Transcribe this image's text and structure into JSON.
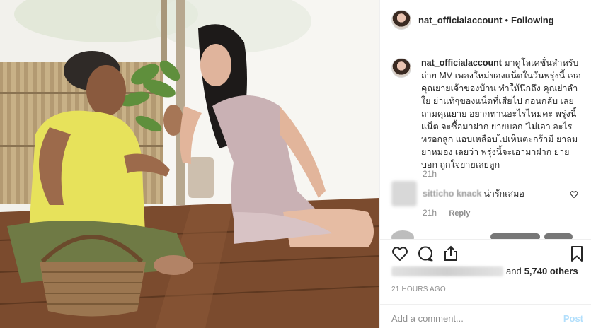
{
  "header": {
    "username": "nat_officialaccount",
    "separator": "•",
    "follow_status": "Following"
  },
  "caption": {
    "username": "nat_officialaccount",
    "text": "มาดูโลเคชั่นสำหรับถ่าย MV เพลงใหม่ของแน็ตในวันพรุ่งนี้ เจอคุณยายเจ้าของบ้าน ทำให้นึกถึง คุณย่าลำใย ย่าแท้ๆของแน็ตที่เสียไป ก่อนกลับ เลยถามคุณยาย อยากทานอะไรไหมคะ พรุ่งนี้แน็ต จะซื้อมาฝาก ยายบอก 'ไม่เอา อะไรหรอกลูก แอบเหลือบไปเห็นตะกร้ามี ยาลมยาหม่อง เลยว่า พรุ่งนี้จะเอามาฝาก ยายบอก ถูกใจยายเลยลูก",
    "time": "21h"
  },
  "comment": {
    "username": "sitticho knack",
    "text": "น่ารักเสมอ",
    "time": "21h",
    "reply_label": "Reply"
  },
  "likes": {
    "and_label": "and",
    "count_label": "5,740 others"
  },
  "post_age": "21 HOURS AGO",
  "add_comment": {
    "placeholder": "Add a comment...",
    "post_label": "Post"
  },
  "icons": {
    "like": "heart-icon",
    "comment": "comment-icon",
    "share": "share-icon",
    "save": "bookmark-icon",
    "comment_like": "heart-icon"
  },
  "colors": {
    "text": "#262626",
    "muted": "#8e8e8e",
    "divider": "#efefef",
    "post_disabled": "#b2dffc"
  }
}
